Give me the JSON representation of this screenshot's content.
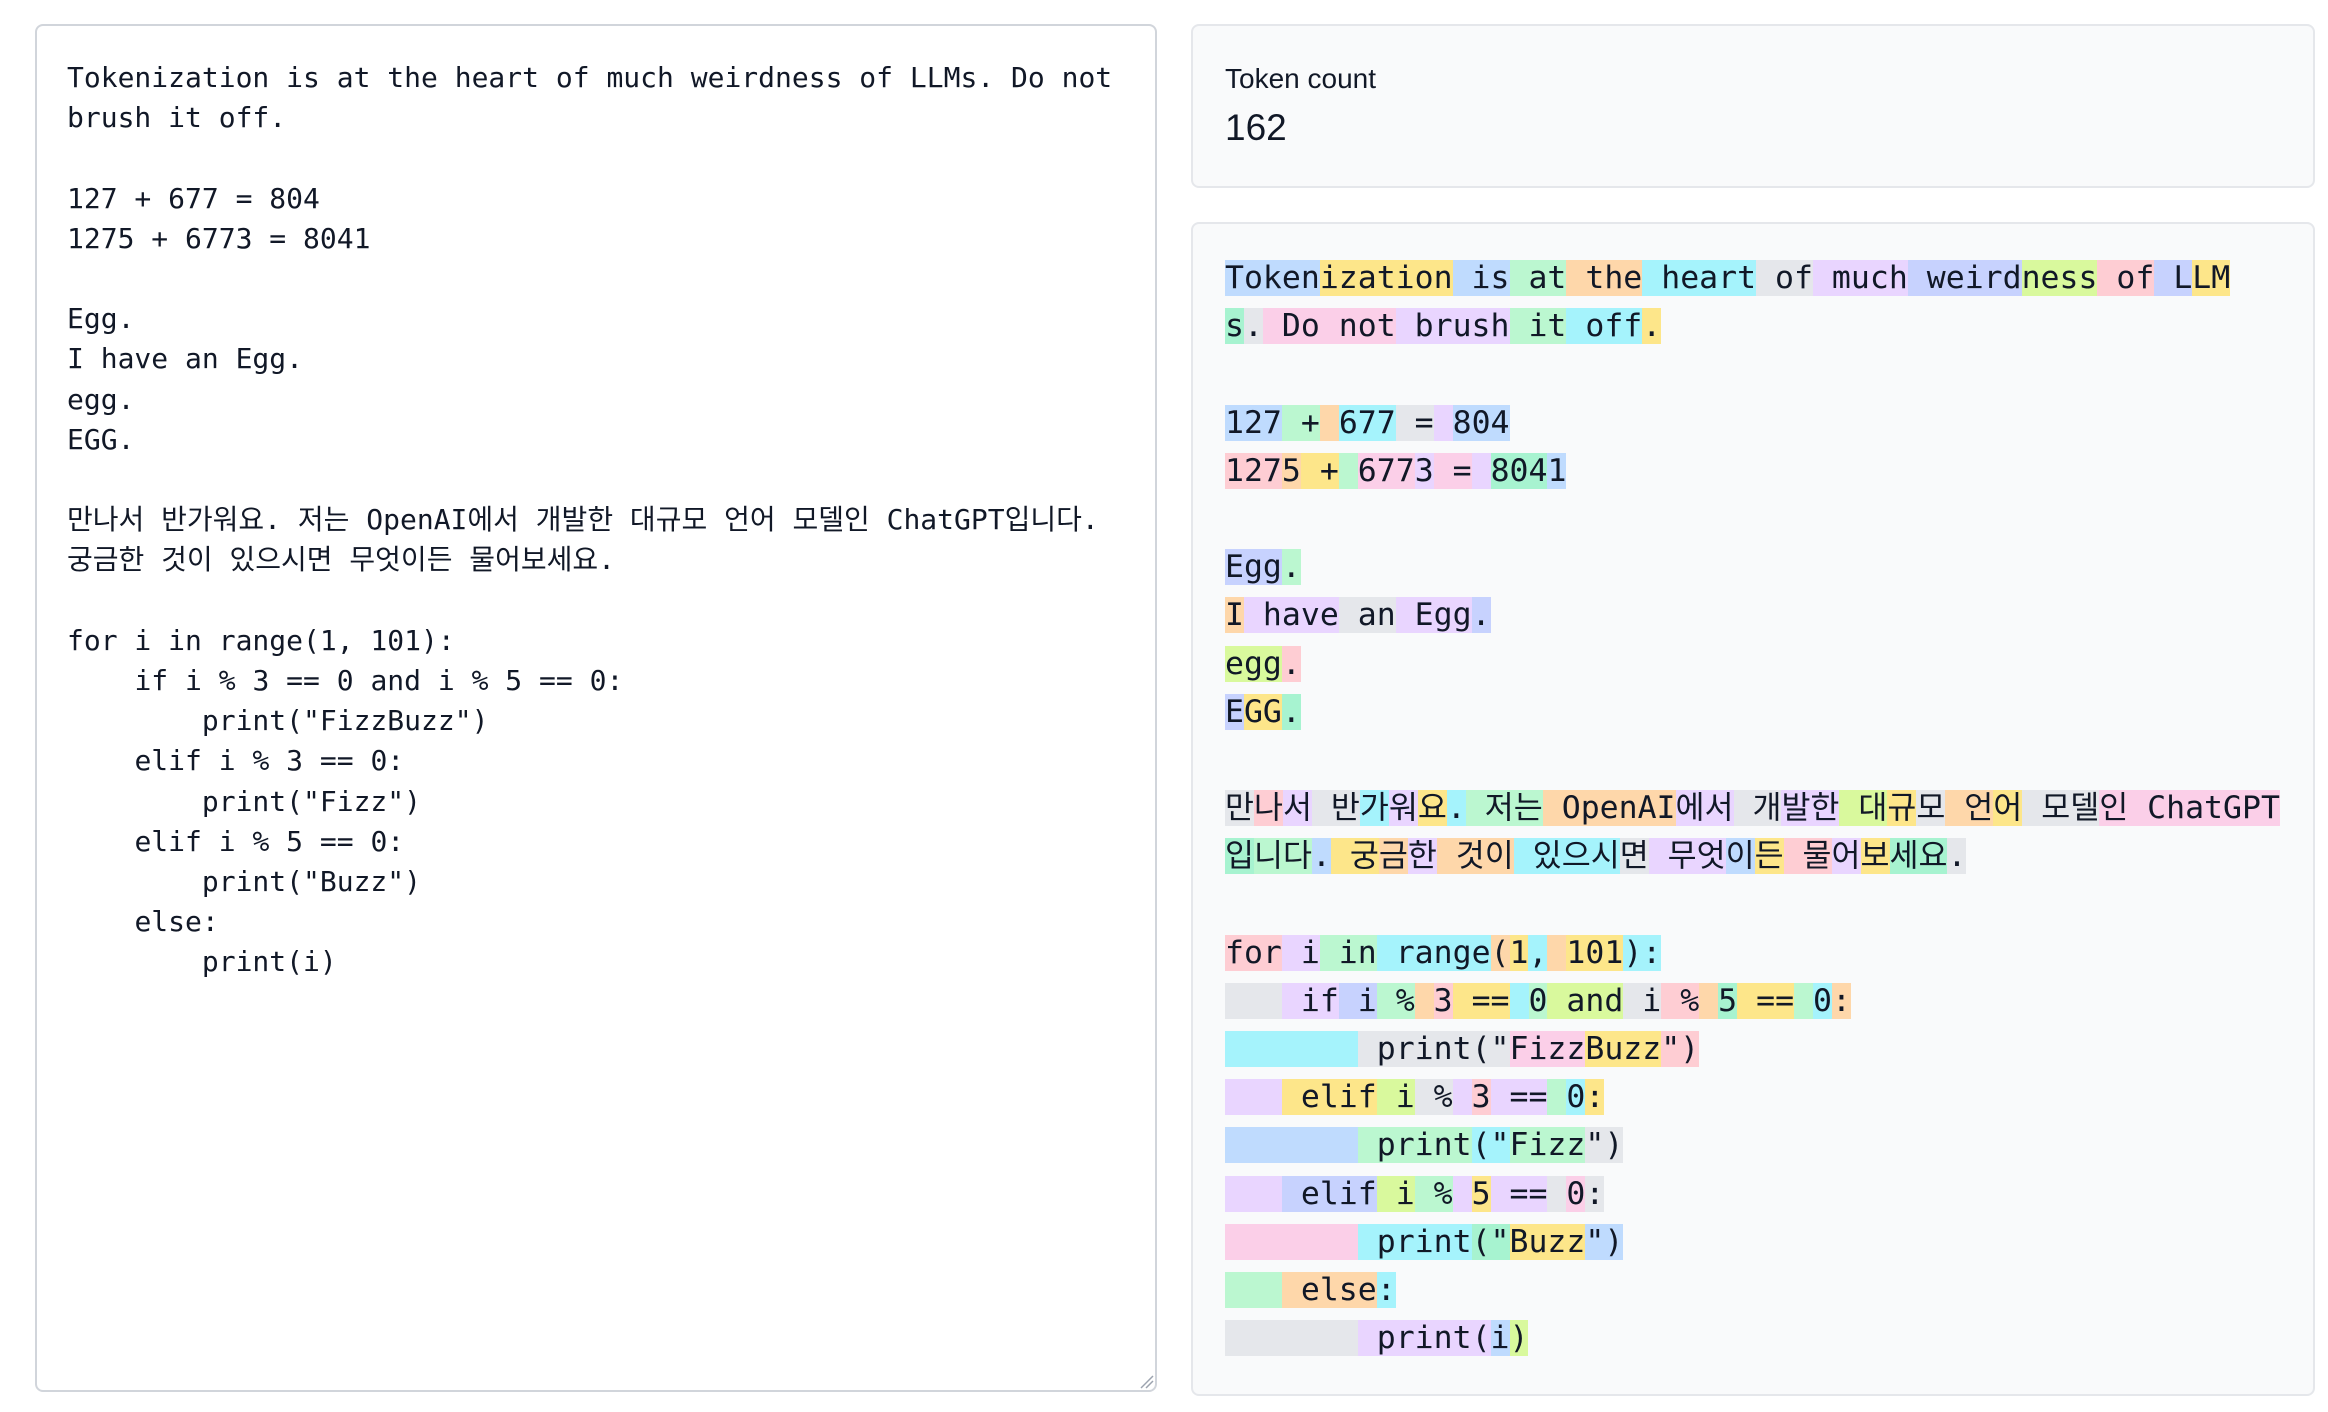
{
  "editor": {
    "text": "Tokenization is at the heart of much weirdness of LLMs. Do not brush it off.\n\n127 + 677 = 804\n1275 + 6773 = 8041\n\nEgg.\nI have an Egg.\negg.\nEGG.\n\n만나서 반가워요. 저는 OpenAI에서 개발한 대규모 언어 모델인 ChatGPT입니다. 궁금한 것이 있으시면 무엇이든 물어보세요.\n\nfor i in range(1, 101):\n    if i % 3 == 0 and i % 5 == 0:\n        print(\"FizzBuzz\")\n    elif i % 3 == 0:\n        print(\"Fizz\")\n    elif i % 5 == 0:\n        print(\"Buzz\")\n    else:\n        print(i)"
  },
  "token_count": {
    "label": "Token count",
    "value": "162"
  },
  "token_colors": [
    "#bfdbfe",
    "#fde68a",
    "#a5f3fc",
    "#bbf7d0",
    "#fed7aa",
    "#e5e7eb",
    "#e9d5ff",
    "#c7d2fe",
    "#d9f99d",
    "#fecdd3",
    "#fbcfe8",
    "#a7f3d0"
  ],
  "token_lines": [
    [
      [
        "Token",
        0
      ],
      [
        "ization",
        1
      ],
      [
        " is",
        0
      ],
      [
        " at",
        3
      ],
      [
        " the",
        4
      ],
      [
        " heart",
        2
      ],
      [
        " of",
        5
      ],
      [
        " much",
        6
      ],
      [
        " weird",
        7
      ],
      [
        "ness",
        8
      ],
      [
        " of",
        9
      ],
      [
        " L",
        7
      ],
      [
        "LM",
        1
      ]
    ],
    [
      [
        "s",
        11
      ],
      [
        ".",
        5
      ],
      [
        " Do",
        10
      ],
      [
        " not",
        10
      ],
      [
        " brush",
        6
      ],
      [
        " it",
        3
      ],
      [
        " off",
        2
      ],
      [
        ".",
        1
      ]
    ],
    [],
    [
      [
        "127",
        0
      ],
      [
        " +",
        3
      ],
      [
        " ",
        4
      ],
      [
        "677",
        2
      ],
      [
        " =",
        5
      ],
      [
        " ",
        6
      ],
      [
        "804",
        0
      ]
    ],
    [
      [
        "127",
        9
      ],
      [
        "5",
        4
      ],
      [
        " +",
        1
      ],
      [
        " ",
        3
      ],
      [
        "677",
        10
      ],
      [
        "3",
        6
      ],
      [
        " =",
        10
      ],
      [
        " ",
        6
      ],
      [
        "804",
        11
      ],
      [
        "1",
        0
      ]
    ],
    [],
    [
      [
        "Egg",
        7
      ],
      [
        ".",
        3
      ]
    ],
    [
      [
        "I",
        4
      ],
      [
        " have",
        6
      ],
      [
        " an",
        5
      ],
      [
        " Egg",
        6
      ],
      [
        ".",
        7
      ]
    ],
    [
      [
        "egg",
        8
      ],
      [
        ".",
        9
      ]
    ],
    [
      [
        "E",
        7
      ],
      [
        "GG",
        1
      ],
      [
        ".",
        11
      ]
    ],
    [],
    [
      [
        "만",
        5
      ],
      [
        "나",
        9
      ],
      [
        "서",
        6
      ],
      [
        " 반",
        5
      ],
      [
        "가",
        2
      ],
      [
        "워",
        6
      ],
      [
        "요",
        1
      ],
      [
        ".",
        2
      ],
      [
        " 저",
        3
      ],
      [
        "는",
        3
      ],
      [
        " Open",
        4
      ],
      [
        "AI",
        4
      ],
      [
        "에서",
        6
      ],
      [
        " 개",
        5
      ],
      [
        "발한",
        6
      ],
      [
        " 대",
        8
      ],
      [
        "규",
        1
      ],
      [
        "모",
        5
      ],
      [
        " 언",
        4
      ],
      [
        "어",
        1
      ],
      [
        " 모",
        5
      ],
      [
        "델",
        5
      ],
      [
        "인",
        10
      ],
      [
        " Chat",
        10
      ],
      [
        "GPT",
        10
      ]
    ],
    [
      [
        "입",
        11
      ],
      [
        "니다",
        3
      ],
      [
        ".",
        0
      ],
      [
        " 궁",
        1
      ],
      [
        "금",
        4
      ],
      [
        "한",
        6
      ],
      [
        " 것이",
        4
      ],
      [
        " 있",
        2
      ],
      [
        "으시",
        2
      ],
      [
        "면",
        5
      ],
      [
        " 무",
        6
      ],
      [
        "엇",
        6
      ],
      [
        "이",
        0
      ],
      [
        "든",
        1
      ],
      [
        " 물",
        9
      ],
      [
        "어",
        6
      ],
      [
        "보",
        1
      ],
      [
        "세요",
        11
      ],
      [
        ".",
        5
      ]
    ],
    [],
    [
      [
        "for",
        9
      ],
      [
        " i",
        6
      ],
      [
        " in",
        3
      ],
      [
        " range",
        2
      ],
      [
        "(",
        4
      ],
      [
        "1",
        1
      ],
      [
        ",",
        2
      ],
      [
        " ",
        4
      ],
      [
        "101",
        1
      ],
      [
        "):",
        2
      ]
    ],
    [
      [
        "   ",
        5
      ],
      [
        " if",
        6
      ],
      [
        " i",
        7
      ],
      [
        " %",
        3
      ],
      [
        " ",
        4
      ],
      [
        "3",
        9
      ],
      [
        " ==",
        1
      ],
      [
        " ",
        2
      ],
      [
        "0",
        3
      ],
      [
        " and",
        8
      ],
      [
        " i",
        5
      ],
      [
        " %",
        9
      ],
      [
        " ",
        4
      ],
      [
        "5",
        11
      ],
      [
        " ==",
        1
      ],
      [
        " ",
        3
      ],
      [
        "0",
        2
      ],
      [
        ":",
        4
      ]
    ],
    [
      [
        "       ",
        2
      ],
      [
        " print",
        5
      ],
      [
        "(\"",
        5
      ],
      [
        "Fizz",
        10
      ],
      [
        "Buzz",
        1
      ],
      [
        "\")",
        9
      ]
    ],
    [
      [
        "   ",
        6
      ],
      [
        " elif",
        1
      ],
      [
        " i",
        8
      ],
      [
        " %",
        5
      ],
      [
        " ",
        6
      ],
      [
        "3",
        9
      ],
      [
        " ==",
        6
      ],
      [
        " ",
        3
      ],
      [
        "0",
        2
      ],
      [
        ":",
        1
      ]
    ],
    [
      [
        "       ",
        0
      ],
      [
        " print",
        3
      ],
      [
        "(\"",
        2
      ],
      [
        "Fizz",
        3
      ],
      [
        "\")",
        5
      ]
    ],
    [
      [
        "   ",
        6
      ],
      [
        " elif",
        7
      ],
      [
        " i",
        8
      ],
      [
        " %",
        3
      ],
      [
        " ",
        6
      ],
      [
        "5",
        1
      ],
      [
        " ==",
        6
      ],
      [
        " ",
        5
      ],
      [
        "0",
        10
      ],
      [
        ":",
        5
      ]
    ],
    [
      [
        "       ",
        10
      ],
      [
        " print",
        2
      ],
      [
        "(\"",
        11
      ],
      [
        "Buzz",
        1
      ],
      [
        "\")",
        0
      ]
    ],
    [
      [
        "   ",
        3
      ],
      [
        " else",
        4
      ],
      [
        ":",
        2
      ]
    ],
    [
      [
        "       ",
        5
      ],
      [
        " print",
        6
      ],
      [
        "(",
        6
      ],
      [
        "i",
        0
      ],
      [
        ")",
        8
      ]
    ]
  ]
}
